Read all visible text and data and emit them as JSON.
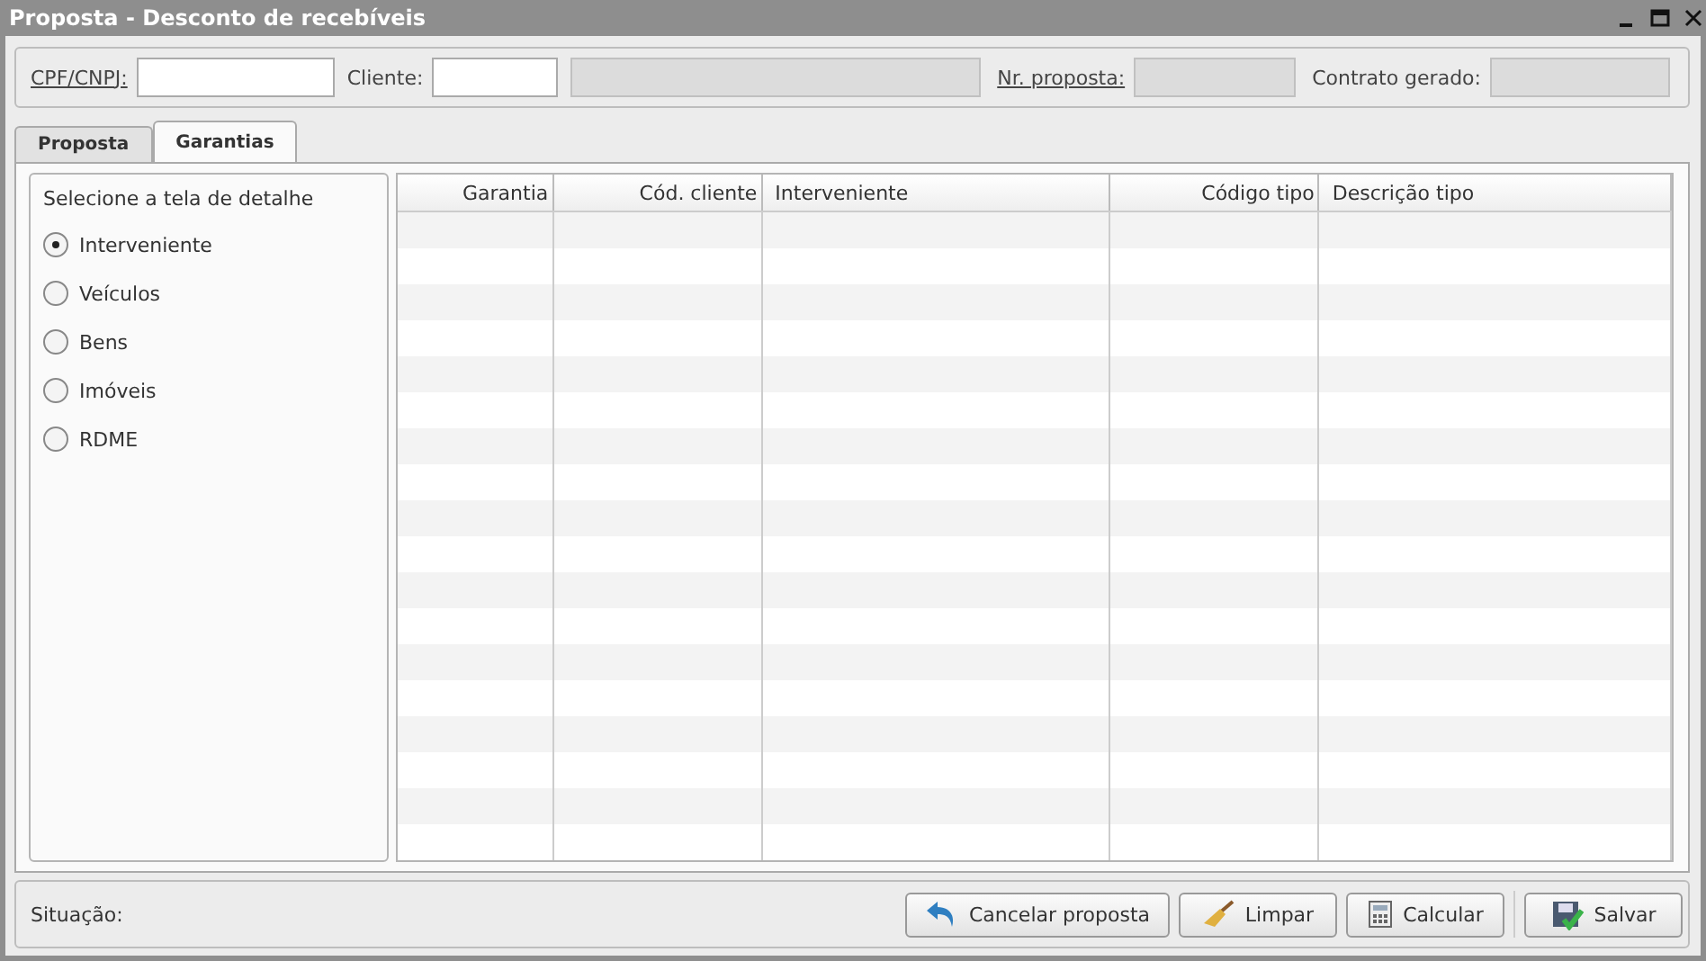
{
  "window": {
    "title": "Proposta - Desconto de recebíveis"
  },
  "header_fields": [
    {
      "label": "CPF/CNPJ:",
      "link": true,
      "inputs": [
        {
          "disabled": false
        }
      ]
    },
    {
      "label": "Cliente:",
      "link": false,
      "inputs": [
        {
          "disabled": false
        },
        {
          "disabled": true
        }
      ]
    },
    {
      "label": "Nr. proposta:",
      "link": true,
      "inputs": [
        {
          "disabled": true
        }
      ]
    },
    {
      "label": "Contrato gerado:",
      "link": false,
      "inputs": [
        {
          "disabled": true
        }
      ]
    }
  ],
  "tabs": [
    {
      "label": "Proposta",
      "selected": false
    },
    {
      "label": "Garantias",
      "selected": true
    }
  ],
  "detail_panel": {
    "title": "Selecione a tela de detalhe",
    "options": [
      {
        "label": "Interveniente",
        "selected": true
      },
      {
        "label": "Veículos",
        "selected": false
      },
      {
        "label": "Bens",
        "selected": false
      },
      {
        "label": "Imóveis",
        "selected": false
      },
      {
        "label": "RDME",
        "selected": false
      }
    ]
  },
  "table": {
    "columns": [
      {
        "label": "Garantia"
      },
      {
        "label": "Cód. cliente"
      },
      {
        "label": "Interveniente"
      },
      {
        "label": "Código tipo"
      },
      {
        "label": "Descrição tipo"
      }
    ]
  },
  "status_bar": {
    "label": "Situação:"
  },
  "buttons": [
    {
      "label": "Cancelar proposta",
      "kind": "undo"
    },
    {
      "label": "Limpar",
      "kind": "broom"
    },
    {
      "label": "Calcular",
      "kind": "calculator"
    },
    {
      "label": "Salvar",
      "kind": "save"
    }
  ]
}
